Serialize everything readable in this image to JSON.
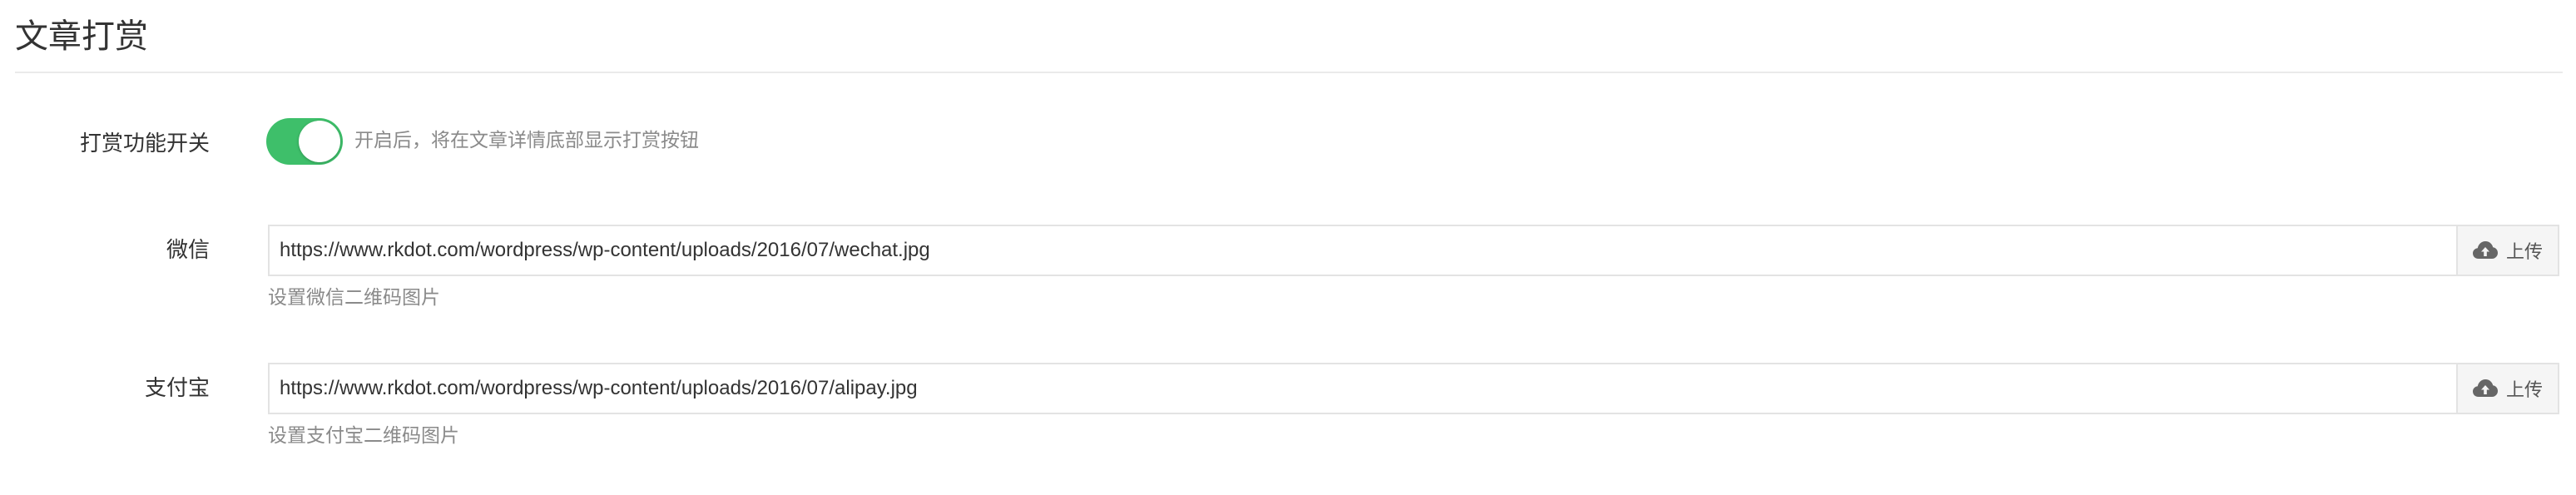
{
  "page": {
    "title": "文章打赏"
  },
  "reward_toggle": {
    "label": "打赏功能开关",
    "enabled": true,
    "hint": "开启后，将在文章详情底部显示打赏按钮"
  },
  "wechat": {
    "label": "微信",
    "value": "https://www.rkdot.com/wordpress/wp-content/uploads/2016/07/wechat.jpg",
    "upload_label": "上传",
    "help": "设置微信二维码图片"
  },
  "alipay": {
    "label": "支付宝",
    "value": "https://www.rkdot.com/wordpress/wp-content/uploads/2016/07/alipay.jpg",
    "upload_label": "上传",
    "help": "设置支付宝二维码图片"
  },
  "icons": {
    "upload": "cloud-upload-icon"
  },
  "colors": {
    "toggle_on": "#3ebf6a",
    "hint_text": "#8a8a8a",
    "border": "#e3e3e3"
  }
}
